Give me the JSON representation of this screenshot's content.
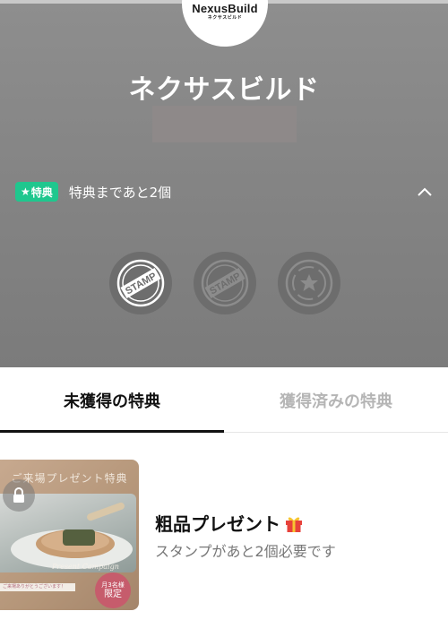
{
  "logo": {
    "title": "NexusBuild",
    "subtitle": "ネクサスビルド"
  },
  "shop": {
    "name": "ネクサスビルド"
  },
  "benefit": {
    "badge_star": "★",
    "badge_label": "特典",
    "status_text": "特典まであと2個",
    "collapse_icon": "chevron-up-icon"
  },
  "stamps": [
    {
      "label": "STAMP",
      "state": "acquired"
    },
    {
      "label": "STAMP",
      "state": "empty"
    },
    {
      "label": "",
      "state": "reward-star"
    }
  ],
  "tabs": [
    {
      "label": "未獲得の特典",
      "active": true
    },
    {
      "label": "獲得済みの特典",
      "active": false
    }
  ],
  "reward": {
    "thumb_headline": "ご来場プレゼント特典",
    "thumb_script": "Present Campaign",
    "thumb_thanks": "ご来場ありがとうございます！",
    "limited_small": "月3名様",
    "limited_big": "限定",
    "title": "粗品プレゼント",
    "subtitle": "スタンプがあと2個必要です"
  },
  "colors": {
    "badge": "#1fc78e",
    "hero_bg": "#878787",
    "active_tab": "#111111",
    "inactive_tab": "#b5b5b5"
  }
}
